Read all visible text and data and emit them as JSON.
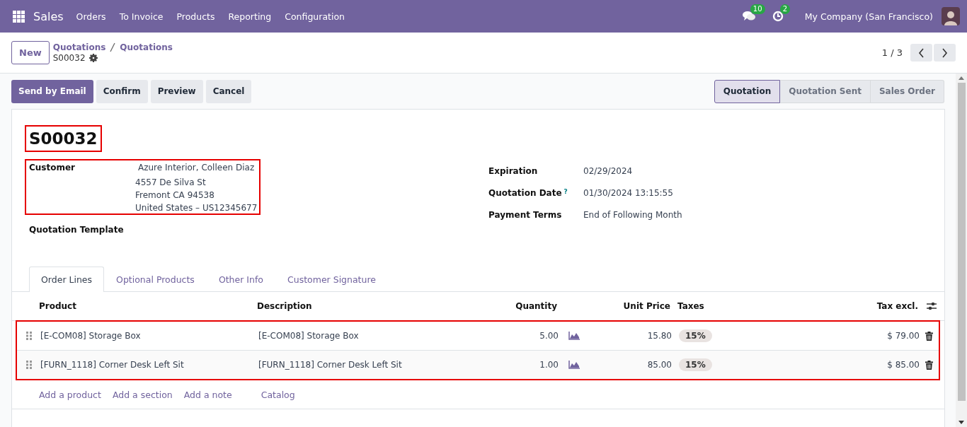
{
  "navbar": {
    "app": "Sales",
    "menu": [
      "Orders",
      "To Invoice",
      "Products",
      "Reporting",
      "Configuration"
    ],
    "messages_count": "10",
    "activities_count": "2",
    "company": "My Company (San Francisco)"
  },
  "control_panel": {
    "new_button": "New",
    "breadcrumb": [
      "Quotations",
      "Quotations"
    ],
    "record": "S00032",
    "pager": "1 / 3"
  },
  "actions": [
    {
      "label": "Send by Email",
      "primary": true
    },
    {
      "label": "Confirm",
      "primary": false
    },
    {
      "label": "Preview",
      "primary": false
    },
    {
      "label": "Cancel",
      "primary": false
    }
  ],
  "stages": [
    {
      "label": "Quotation",
      "selected": true
    },
    {
      "label": "Quotation Sent",
      "selected": false
    },
    {
      "label": "Sales Order",
      "selected": false
    }
  ],
  "form": {
    "name": "S00032",
    "name_highlighted": true,
    "customer": {
      "label": "Customer",
      "name": "Azure Interior, Colleen Diaz",
      "address": [
        "4557 De Silva St",
        "Fremont CA 94538",
        "United States – US12345677"
      ],
      "highlighted": true
    },
    "quotation_template": {
      "label": "Quotation Template"
    },
    "right_fields": [
      {
        "label": "Expiration",
        "value": "02/29/2024"
      },
      {
        "label": "Quotation Date",
        "help_mark": "?",
        "value": "01/30/2024 13:15:55"
      },
      {
        "label": "Payment Terms",
        "value": "End of Following Month"
      }
    ]
  },
  "tabs": [
    {
      "label": "Order Lines",
      "selected": true
    },
    {
      "label": "Optional Products",
      "selected": false
    },
    {
      "label": "Other Info",
      "selected": false
    },
    {
      "label": "Customer Signature",
      "selected": false
    }
  ],
  "order_lines": {
    "columns": [
      "Product",
      "Description",
      "Quantity",
      "Unit Price",
      "Taxes",
      "Tax excl."
    ],
    "highlighted": true,
    "rows": [
      {
        "product": "[E-COM08] Storage Box",
        "description": "[E-COM08] Storage Box",
        "quantity": "5.00",
        "unit_price": "15.80",
        "taxes": "15%",
        "subtotal": "$ 79.00"
      },
      {
        "product": "[FURN_1118] Corner Desk Left Sit",
        "description": "[FURN_1118] Corner Desk Left Sit",
        "quantity": "1.00",
        "unit_price": "85.00",
        "taxes": "15%",
        "subtotal": "$ 85.00"
      }
    ],
    "add_links": [
      "Add a product",
      "Add a section",
      "Add a note"
    ],
    "catalog": "Catalog"
  }
}
